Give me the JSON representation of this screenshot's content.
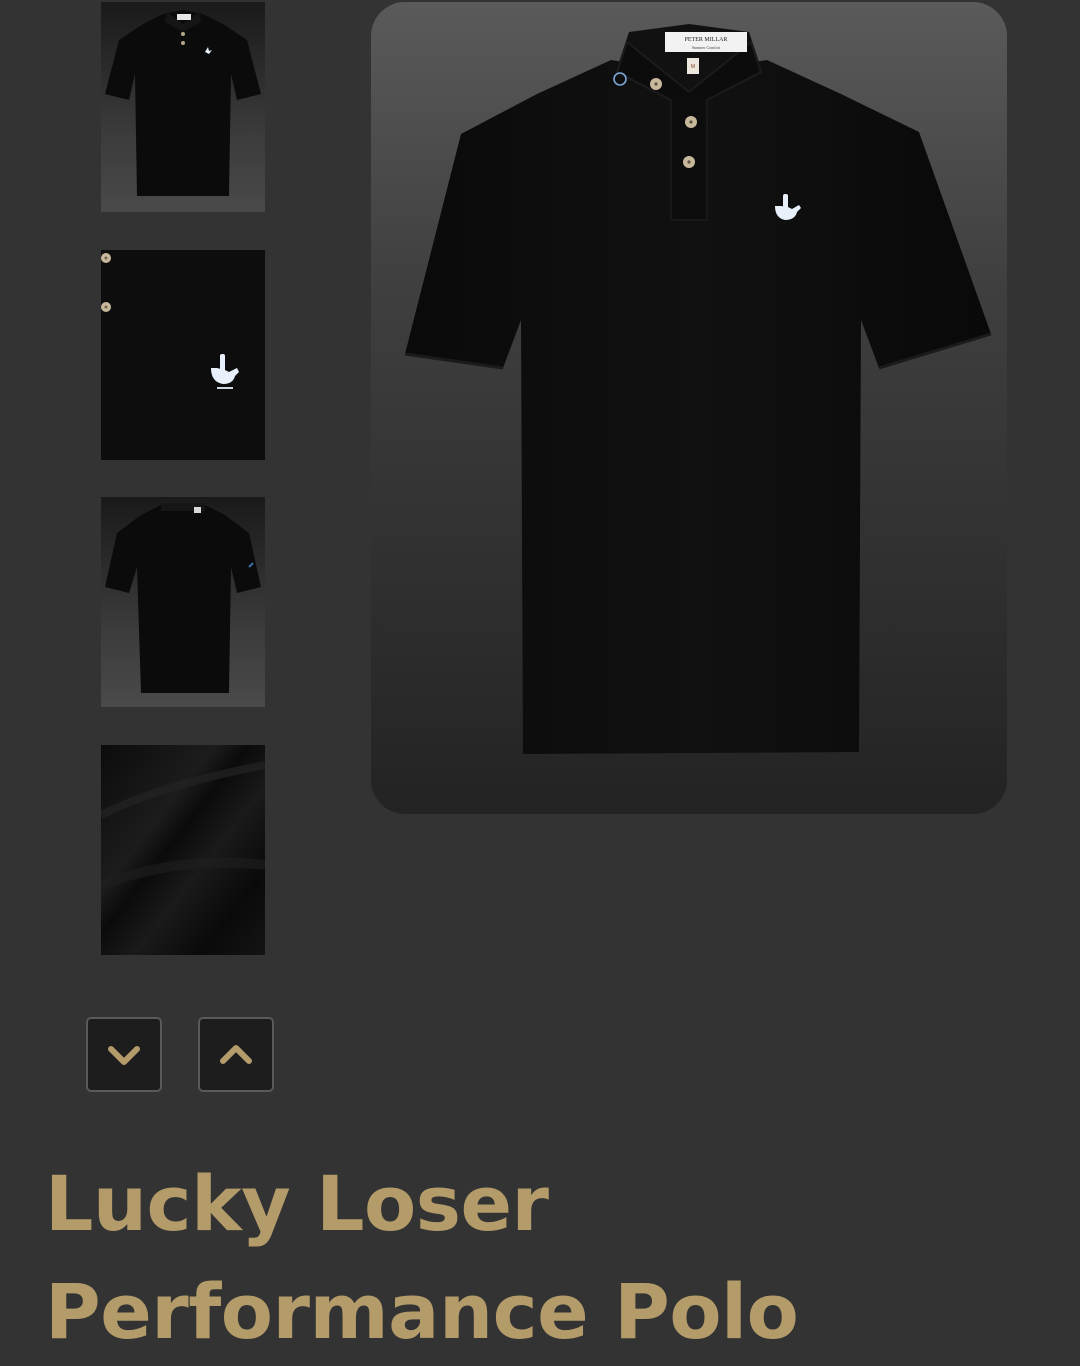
{
  "gallery": {
    "thumbnails": [
      {
        "name": "front",
        "alt": "Front view"
      },
      {
        "name": "logo-detail",
        "alt": "Logo detail"
      },
      {
        "name": "back",
        "alt": "Back view"
      },
      {
        "name": "fabric",
        "alt": "Fabric texture"
      }
    ],
    "main_image": {
      "collar_label_line1": "PETER MILLAR",
      "collar_label_line2": "Summer Comfort",
      "size_tag": "M"
    },
    "scroll_down_icon": "chevron-down-icon",
    "scroll_up_icon": "chevron-up-icon"
  },
  "product": {
    "title": "Lucky Loser Performance Polo"
  },
  "colors": {
    "background": "#333333",
    "accent_gold": "#b39b6a",
    "shirt": "#0b0b0b",
    "logo": "#e8f1fb"
  }
}
